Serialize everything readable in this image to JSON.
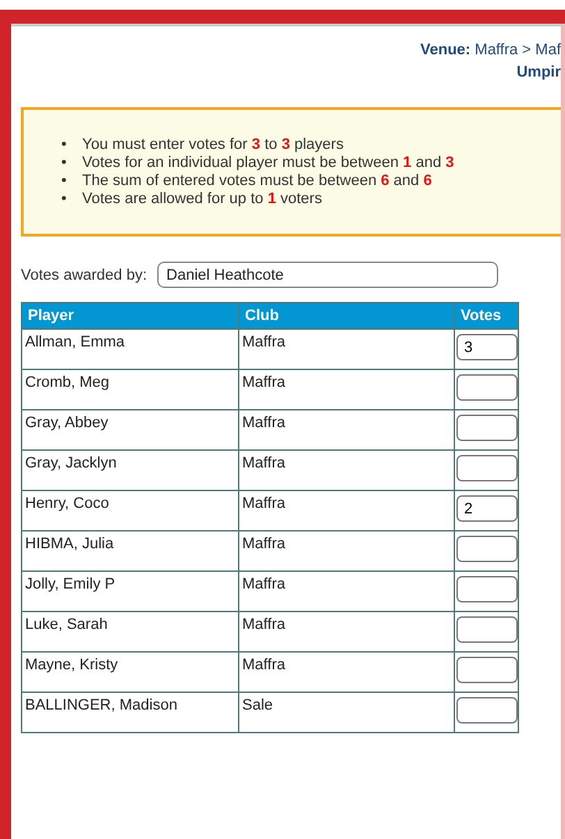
{
  "header": {
    "venue_label": "Venue:",
    "venue_value": "Maffra > Maf",
    "line_2": "Umpir"
  },
  "bullet": "•",
  "rules": [
    "You must enter votes for **3** to **3** players",
    "Votes for an individual player must be between **1** and **3**",
    "The sum of entered votes must be between **6** and **6**",
    "Votes are allowed for up to **1** voters"
  ],
  "awarded_by": {
    "label": "Votes awarded by:",
    "value": "Daniel Heathcote"
  },
  "table": {
    "columns": [
      "Player",
      "Club",
      "Votes"
    ],
    "rows": [
      {
        "player": "Allman, Emma",
        "club": "Maffra",
        "votes": "3"
      },
      {
        "player": "Cromb, Meg",
        "club": "Maffra",
        "votes": ""
      },
      {
        "player": "Gray, Abbey",
        "club": "Maffra",
        "votes": ""
      },
      {
        "player": "Gray, Jacklyn",
        "club": "Maffra",
        "votes": ""
      },
      {
        "player": "Henry, Coco",
        "club": "Maffra",
        "votes": "2"
      },
      {
        "player": "HIBMA, Julia",
        "club": "Maffra",
        "votes": ""
      },
      {
        "player": "Jolly, Emily P",
        "club": "Maffra",
        "votes": ""
      },
      {
        "player": "Luke, Sarah",
        "club": "Maffra",
        "votes": ""
      },
      {
        "player": "Mayne, Kristy",
        "club": "Maffra",
        "votes": ""
      },
      {
        "player": "BALLINGER, Madison",
        "club": "Sale",
        "votes": ""
      }
    ]
  }
}
